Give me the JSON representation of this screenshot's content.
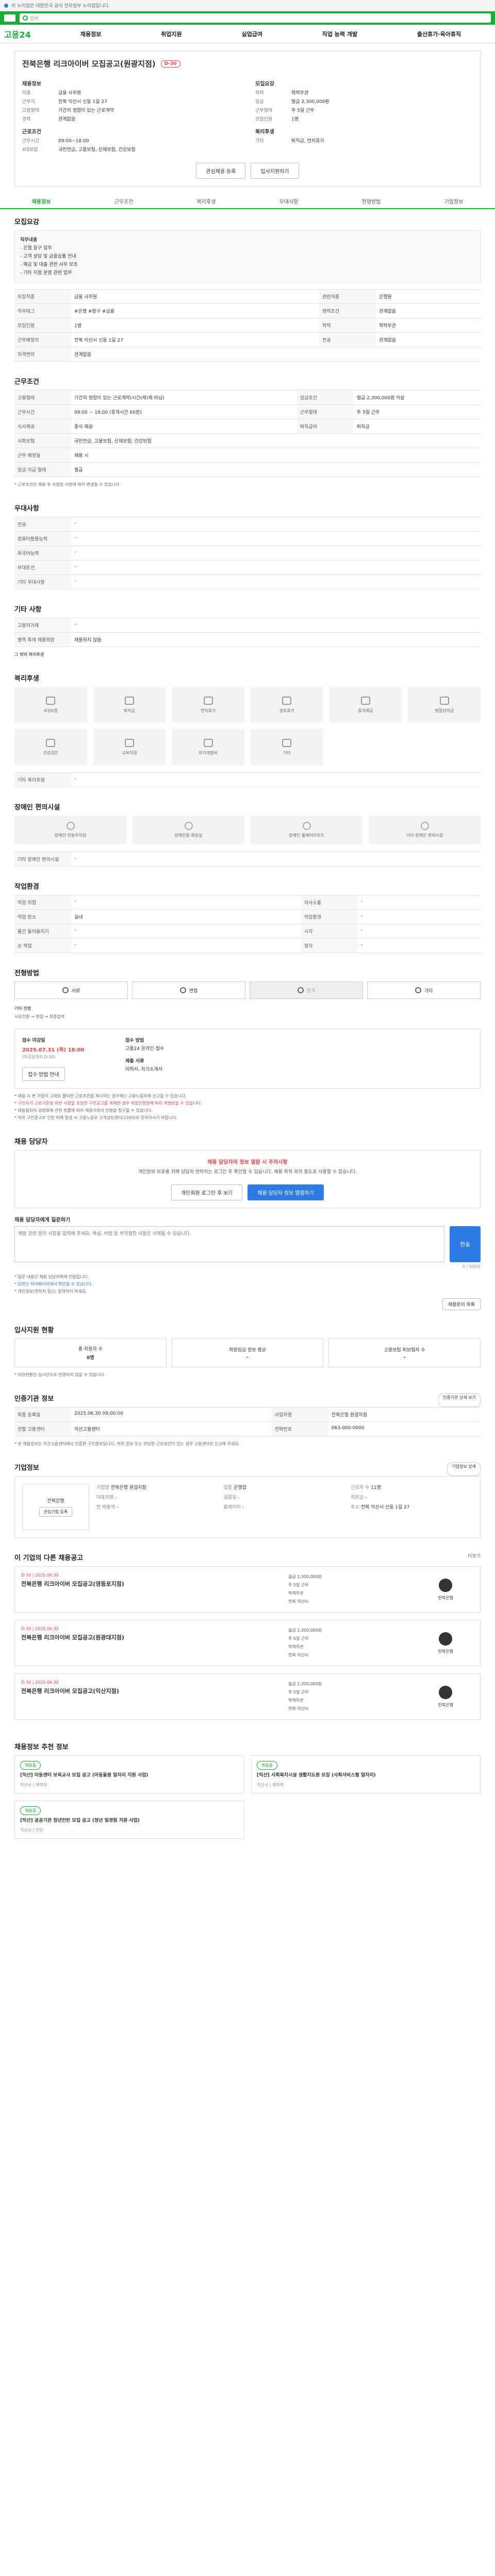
{
  "topbar": {
    "text": "이 누리집은 대한민국 공식 전자정부 누리집입니다."
  },
  "search": {
    "placeholder": "검색"
  },
  "gnb": {
    "brand": "고용24",
    "menu": [
      "채용정보",
      "취업지원",
      "실업급여",
      "직업 능력 개발",
      "출산휴가·육아휴직"
    ]
  },
  "tabs": [
    "채용정보",
    "근무조건",
    "복리후생",
    "우대사항",
    "전형방법",
    "기업정보"
  ],
  "job": {
    "title": "전북은행 리크아이버 모집공고(원광지점)",
    "badge": "D-30",
    "left_group": "채용정보",
    "left": [
      {
        "k": "직종",
        "v": "금융 사무원"
      },
      {
        "k": "근무지",
        "v": "전북 익산시 신동 1길 27"
      },
      {
        "k": "고용형태",
        "v": "기간의 정함이 있는 근로계약"
      },
      {
        "k": "경력",
        "v": "관계없음"
      }
    ],
    "right_group": "모집요강",
    "right": [
      {
        "k": "학력",
        "v": "학력무관"
      },
      {
        "k": "임금",
        "v": "월급 2,300,000원"
      },
      {
        "k": "근무형태",
        "v": "주 5일 근무"
      },
      {
        "k": "모집인원",
        "v": "1명"
      }
    ],
    "left2_group": "근로조건",
    "left2": [
      {
        "k": "근무시간",
        "v": "09:00~18:00"
      },
      {
        "k": "4대보험",
        "v": "국민연금, 고용보험, 산재보험, 건강보험"
      }
    ],
    "right2_group": "복리후생",
    "right2": [
      {
        "k": "기타",
        "v": "퇴직금, 연차휴가"
      }
    ],
    "btn_interest": "관심채용 등록",
    "btn_apply": "입사지원하기"
  },
  "recruit": {
    "title": "모집요강",
    "intro_label": "직무내용",
    "intro": [
      "- 은행 창구 업무",
      "- 고객 상담 및 금융상품 안내",
      "- 예금 및 대출 관련 사무 보조",
      "- 기타 지점 운영 관련 업무"
    ],
    "rows": [
      {
        "h": "모집직종",
        "v": "금융 사무원",
        "h2": "관련직종",
        "v2": "은행원"
      },
      {
        "h": "직무태그",
        "v": "#은행 #창구 #금융",
        "h2": "경력조건",
        "v2": "관계없음"
      },
      {
        "h": "모집인원",
        "v": "1명",
        "h2": "학력",
        "v2": "학력무관"
      },
      {
        "h": "근무예정지",
        "v": "전북 익산시 신동 1길 27",
        "h2": "전공",
        "v2": "관계없음"
      },
      {
        "h": "자격면허",
        "v": "관계없음",
        "h2": "",
        "v2": ""
      }
    ]
  },
  "condition": {
    "title": "근무조건",
    "rows": [
      {
        "h": "고용형태",
        "v": "기간의 정함이 있는 근로계약(시간(제)제 아님)",
        "h2": "임금조건",
        "v2": "월급 2,300,000원 이상"
      },
      {
        "h": "근무시간",
        "v": "09:00 ~ 18:00 (휴게시간 60분)",
        "h2": "근무형태",
        "v2": "주 5일 근무"
      },
      {
        "h": "식사제공",
        "v": "중식 제공",
        "h2": "퇴직급여",
        "v2": "퇴직금"
      },
      {
        "h": "사회보험",
        "v": "국민연금, 고용보험, 산재보험, 건강보험",
        "h2": "",
        "v2": ""
      },
      {
        "h": "근무 예정일",
        "v": "채용 시",
        "h2": "",
        "v2": ""
      },
      {
        "h": "임금 지급 형태",
        "v": "월급",
        "h2": "",
        "v2": ""
      }
    ],
    "note": "* 근로조건은 채용 후 사업장 사정에 따라 변경될 수 있습니다."
  },
  "prefer": {
    "title": "우대사항",
    "rows": [
      {
        "h": "전공",
        "v": "-"
      },
      {
        "h": "컴퓨터활용능력",
        "v": "-"
      },
      {
        "h": "외국어능력",
        "v": "-"
      },
      {
        "h": "우대조건",
        "v": "-"
      },
      {
        "h": "기타 우대사항",
        "v": "-"
      }
    ]
  },
  "etc": {
    "title": "기타 사항",
    "rows": [
      {
        "h": "고용허가제",
        "v": "-"
      },
      {
        "h": "병역 특례 채용희망",
        "v": "채용하지 않음"
      }
    ],
    "sub": "그 밖의 복리후생"
  },
  "welfare": {
    "title": "복리후생",
    "items": [
      "4대보험",
      "퇴직금",
      "연차휴가",
      "경조휴가",
      "중식제공",
      "명절상여금",
      "건강검진",
      "교육지원",
      "자기계발비",
      "기타"
    ],
    "extra_label": "기타 복리후생",
    "extra": "-"
  },
  "disabled": {
    "title": "장애인 편의시설",
    "items": [
      "장애인 전용주차장",
      "장애인용 화장실",
      "장애인 휠체어리프트",
      "기타 장애인 편의시설"
    ],
    "extra_label": "기타 장애인 편의시설",
    "extra": "-"
  },
  "workenv": {
    "title": "작업환경",
    "rows": [
      {
        "h": "작업 위험",
        "v": "-",
        "h2": "의사소통",
        "v2": "-"
      },
      {
        "h": "작업 장소",
        "v": "실내",
        "h2": "작업환경",
        "v2": "-"
      },
      {
        "h": "물건 들어올리기",
        "v": "-",
        "h2": "시각",
        "v2": "-"
      },
      {
        "h": "손 작업",
        "v": "-",
        "h2": "청각",
        "v2": "-"
      }
    ]
  },
  "process": {
    "title": "전형방법",
    "steps": [
      "서류",
      "면접",
      "합격",
      "기타"
    ],
    "sub_label": "기타 전형",
    "sub": "서류전형 → 면접 → 최종합격",
    "date_label": "접수 마감일",
    "deadline": "2025.07.31 (목) 18:00",
    "deadline_note": "(마감일까지 D-30)",
    "method_label": "접수 방법",
    "method": "고용24 온라인 접수",
    "doc_label": "제출 서류",
    "docs": "이력서, 자기소개서",
    "btn": "접수 방법 안내",
    "notices": [
      "* 채용 시 본 기업이 고의로 불리한 근로조건을 제시하는 경우에는 고용노동부에 신고할 수 있습니다.",
      "* 구인자가 근로기준법 위반 사항을 포함한 구인공고를 게재한 경우 직업안정법에 따라 처벌받을 수 있습니다.",
      "* 채용절차의 공정화에 관한 법률에 따라 채용서류의 반환을 청구할 수 있습니다.",
      "* 허위 구인광고로 인한 피해 발생 시 고용노동부 고객상담센터(1350)로 문의하시기 바랍니다."
    ]
  },
  "contact": {
    "title": "채용 담당자",
    "headline": "채용 담당자의 정보 열람 시 주의사항",
    "desc": "개인정보 보호를 위해 담당자 연락처는 로그인 후 확인할 수 있습니다. 채용 목적 외의 용도로 사용할 수 없습니다.",
    "btn1": "개인회원 로그인 후 보기",
    "btn2": "채용 담당자 정보 열람하기",
    "qa_label": "채용 담당자에게 질문하기",
    "qa_placeholder": "채용 관련 문의 사항을 입력해 주세요. 욕설, 비방 등 부적절한 내용은 삭제될 수 있습니다.",
    "qa_count": "0 / 500자",
    "qa_send": "전송",
    "qa_notes": [
      "* 질문 내용은 채용 담당자에게 전달됩니다.",
      "* 답변은 마이페이지에서 확인할 수 있습니다.",
      "* 개인정보(연락처 등)는 입력하지 마세요."
    ],
    "qa_btn": "채용문의 목록"
  },
  "apply": {
    "title": "입사지원 현황",
    "cards": [
      {
        "t": "총 지원자 수",
        "v": "0명"
      },
      {
        "t": "희망임금 정보 평균",
        "v": "-"
      },
      {
        "t": "고용보험 피보험자 수",
        "v": "-"
      }
    ],
    "note": "* 지원현황은 실시간으로 반영되지 않을 수 있습니다."
  },
  "manager": {
    "title": "인증기관 정보",
    "link": "인증기관 상세 보기",
    "rows": [
      {
        "h": "최종 등록일",
        "v": "2025.06.30 09:00:00",
        "h2": "사업자명",
        "v2": "전북은행 원광지점"
      },
      {
        "h": "관할 고용센터",
        "v": "익산고용센터",
        "h2": "전화번호",
        "v2": "063-000-0000"
      }
    ],
    "notice": "* 본 채용정보는 익산고용센터에서 인증한 구인정보입니다. 허위 정보 또는 부당한 근로조건이 있는 경우 고용센터로 신고해 주세요."
  },
  "company": {
    "title": "기업정보",
    "link": "기업정보 상세",
    "logo_text": "전북은행",
    "interest_btn": "관심기업 등록",
    "info": [
      {
        "k": "기업명",
        "v": "전북은행 원광지점"
      },
      {
        "k": "업종",
        "v": "은행업"
      },
      {
        "k": "근로자 수",
        "v": "11명"
      },
      {
        "k": "대표자명",
        "v": "-"
      },
      {
        "k": "설립일",
        "v": "-"
      },
      {
        "k": "자본금",
        "v": "-"
      },
      {
        "k": "연 매출액",
        "v": "-"
      },
      {
        "k": "홈페이지",
        "v": "-"
      },
      {
        "k": "주소",
        "v": "전북 익산시 신동 1길 27"
      }
    ]
  },
  "other_jobs": {
    "title": "이 기업의 다른 채용공고",
    "more": "더보기",
    "items": [
      {
        "tag": "D-30 | 2025.06.30",
        "title": "전북은행 리크아이버 모집공고(영등포지점)",
        "meta": [
          "월급 2,300,000원",
          "주 5일 근무",
          "학력무관",
          "전북 익산시"
        ],
        "company": "전북은행"
      },
      {
        "tag": "D-30 | 2025.06.30",
        "title": "전북은행 리크아이버 모집공고(원광대지점)",
        "meta": [
          "월급 2,300,000원",
          "주 5일 근무",
          "학력무관",
          "전북 익산시"
        ],
        "company": "전북은행"
      },
      {
        "tag": "D-30 | 2025.06.30",
        "title": "전북은행 리크아이버 모집공고(익산지점)",
        "meta": [
          "월급 2,300,000원",
          "주 5일 근무",
          "학력무관",
          "전북 익산시"
        ],
        "company": "전북은행"
      }
    ]
  },
  "similar": {
    "title": "채용정보 추천 정보",
    "items": [
      {
        "tag": "채용중",
        "title": "[익산] 아동센터 보육교사 모집 공고 (아동돌봄 일자리 지원 사업)",
        "meta": "익산시 | 계약직"
      },
      {
        "tag": "채용중",
        "title": "[익산] 사회복지시설 생활지도원 모집 (사회서비스형 일자리)",
        "meta": "익산시 | 계약직"
      },
      {
        "tag": "채용중",
        "title": "[익산] 공공기관 청년인턴 모집 공고 (청년 일경험 지원 사업)",
        "meta": "익산시 | 인턴"
      }
    ]
  },
  "colors": {
    "brand": "#1eaa39",
    "accent": "#2d7be5",
    "danger": "#e44444"
  }
}
